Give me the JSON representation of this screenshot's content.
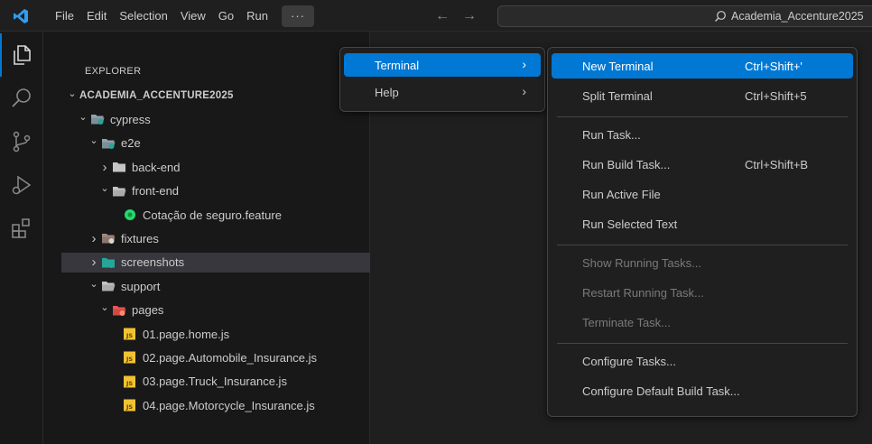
{
  "titlebar": {
    "menus": [
      "File",
      "Edit",
      "Selection",
      "View",
      "Go",
      "Run"
    ],
    "more_label": "···",
    "back_arrow": "←",
    "forward_arrow": "→",
    "search_text": "Academia_Accenture2025"
  },
  "activity_bar": {
    "icons": [
      "explorer-icon",
      "search-icon",
      "source-control-icon",
      "run-debug-icon",
      "extensions-icon"
    ]
  },
  "sidebar": {
    "title": "EXPLORER",
    "tree": [
      {
        "label": "ACADEMIA_ACCENTURE2025",
        "depth": 0,
        "chevron": "down",
        "icon": "none"
      },
      {
        "label": "cypress",
        "depth": 1,
        "chevron": "down",
        "icon": "folder-cypress-open-icon"
      },
      {
        "label": "e2e",
        "depth": 2,
        "chevron": "down",
        "icon": "folder-e2e-open-icon"
      },
      {
        "label": "back-end",
        "depth": 3,
        "chevron": "right",
        "icon": "folder-icon"
      },
      {
        "label": "front-end",
        "depth": 3,
        "chevron": "down",
        "icon": "folder-open-icon"
      },
      {
        "label": "Cotação de seguro.feature",
        "depth": 4,
        "chevron": "none",
        "icon": "cucumber-file-icon"
      },
      {
        "label": "fixtures",
        "depth": 2,
        "chevron": "right",
        "icon": "folder-fixtures-icon"
      },
      {
        "label": "screenshots",
        "depth": 2,
        "chevron": "right",
        "icon": "folder-screenshots-icon",
        "selected": true
      },
      {
        "label": "support",
        "depth": 2,
        "chevron": "down",
        "icon": "folder-open-icon"
      },
      {
        "label": "pages",
        "depth": 3,
        "chevron": "down",
        "icon": "folder-pages-open-icon"
      },
      {
        "label": "01.page.home.js",
        "depth": 4,
        "chevron": "none",
        "icon": "js-file-icon"
      },
      {
        "label": "02.page.Automobile_Insurance.js",
        "depth": 4,
        "chevron": "none",
        "icon": "js-file-icon"
      },
      {
        "label": "03.page.Truck_Insurance.js",
        "depth": 4,
        "chevron": "none",
        "icon": "js-file-icon"
      },
      {
        "label": "04.page.Motorcycle_Insurance.js",
        "depth": 4,
        "chevron": "none",
        "icon": "js-file-icon"
      }
    ]
  },
  "menu_more": {
    "items": [
      {
        "label": "Terminal",
        "arrow": "›",
        "active": true
      },
      {
        "label": "Help",
        "arrow": "›",
        "active": false
      }
    ]
  },
  "menu_terminal": {
    "groups": [
      [
        {
          "label": "New Terminal",
          "shortcut": "Ctrl+Shift+'",
          "active": true,
          "disabled": false
        },
        {
          "label": "Split Terminal",
          "shortcut": "Ctrl+Shift+5",
          "active": false,
          "disabled": false
        }
      ],
      [
        {
          "label": "Run Task...",
          "shortcut": "",
          "active": false,
          "disabled": false
        },
        {
          "label": "Run Build Task...",
          "shortcut": "Ctrl+Shift+B",
          "active": false,
          "disabled": false
        },
        {
          "label": "Run Active File",
          "shortcut": "",
          "active": false,
          "disabled": false
        },
        {
          "label": "Run Selected Text",
          "shortcut": "",
          "active": false,
          "disabled": false
        }
      ],
      [
        {
          "label": "Show Running Tasks...",
          "shortcut": "",
          "active": false,
          "disabled": true
        },
        {
          "label": "Restart Running Task...",
          "shortcut": "",
          "active": false,
          "disabled": true
        },
        {
          "label": "Terminate Task...",
          "shortcut": "",
          "active": false,
          "disabled": true
        }
      ],
      [
        {
          "label": "Configure Tasks...",
          "shortcut": "",
          "active": false,
          "disabled": false
        },
        {
          "label": "Configure Default Build Task...",
          "shortcut": "",
          "active": false,
          "disabled": false
        }
      ]
    ]
  },
  "colors": {
    "accent": "#0078d4",
    "background": "#1f1f1f",
    "sidebar": "#181818",
    "selection": "#37373d"
  }
}
